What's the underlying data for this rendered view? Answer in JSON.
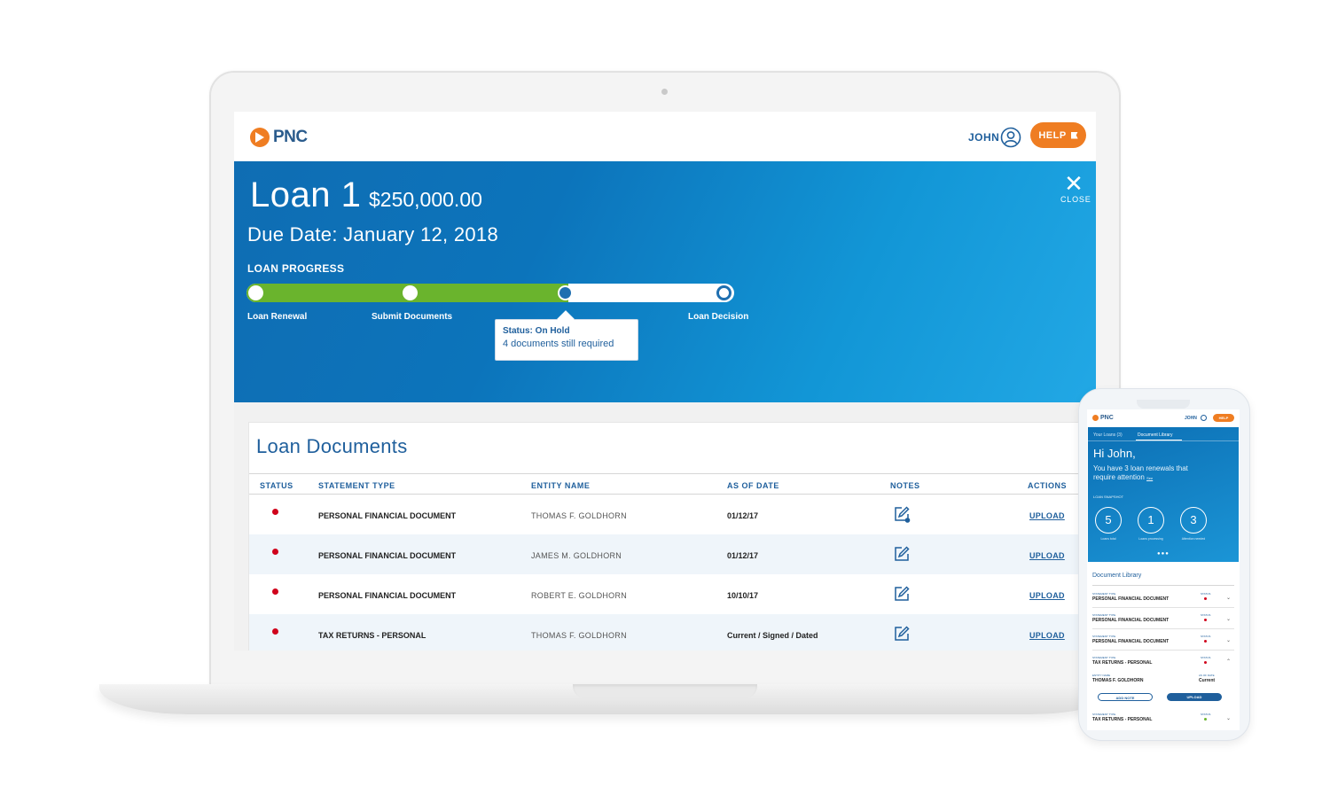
{
  "brand": {
    "name": "PNC",
    "accent": "#ef7d22",
    "primary": "#1f5f9c"
  },
  "header": {
    "user_name": "JOHN",
    "help_label": "HELP"
  },
  "loan": {
    "title": "Loan 1",
    "amount": "$250,000.00",
    "due_date": "Due Date: January 12, 2018",
    "close_label": "CLOSE",
    "progress_label": "LOAN PROGRESS",
    "progress_fraction": 0.66,
    "steps": [
      {
        "label": "Loan Renewal",
        "state": "complete"
      },
      {
        "label": "Submit Documents",
        "state": "complete"
      },
      {
        "label": "",
        "state": "current"
      },
      {
        "label": "Loan Decision",
        "state": "future"
      }
    ],
    "tooltip": {
      "title": "Status: On Hold",
      "subtitle": "4 documents still required"
    }
  },
  "documents": {
    "title": "Loan Documents",
    "columns": [
      "STATUS",
      "STATEMENT TYPE",
      "ENTITY NAME",
      "AS OF DATE",
      "NOTES",
      "ACTIONS"
    ],
    "rows": [
      {
        "statement_type": "PERSONAL FINANCIAL DOCUMENT",
        "entity": "THOMAS F. GOLDHORN",
        "as_of": "01/12/17",
        "action": "UPLOAD",
        "status_color": "#d0021b",
        "has_note": true
      },
      {
        "statement_type": "PERSONAL FINANCIAL DOCUMENT",
        "entity": "JAMES M. GOLDHORN",
        "as_of": "01/12/17",
        "action": "UPLOAD",
        "status_color": "#d0021b",
        "has_note": false
      },
      {
        "statement_type": "PERSONAL FINANCIAL DOCUMENT",
        "entity": "ROBERT E. GOLDHORN",
        "as_of": "10/10/17",
        "action": "UPLOAD",
        "status_color": "#d0021b",
        "has_note": false
      },
      {
        "statement_type": "TAX RETURNS - PERSONAL",
        "entity": "THOMAS F. GOLDHORN",
        "as_of": "Current / Signed / Dated",
        "action": "UPLOAD",
        "status_color": "#d0021b",
        "has_note": false
      }
    ]
  },
  "phone": {
    "brand": "PNC",
    "user_name": "JOHN",
    "help_label": "HELP",
    "tabs": [
      "Your Loans (3)",
      "Document Library"
    ],
    "greeting": "Hi John,",
    "message": "You have 3 loan renewals that require attention",
    "message_link": "See",
    "snapshot_label": "LOAN SNAPSHOT",
    "stats": [
      {
        "value": "5",
        "label": "Loans total"
      },
      {
        "value": "1",
        "label": "Loans processing"
      },
      {
        "value": "3",
        "label": "Attention needed"
      }
    ],
    "library_title": "Document Library",
    "items": [
      {
        "key": "STATEMENT TYPE",
        "value": "PERSONAL FINANCIAL DOCUMENT",
        "status": "STATUS",
        "color": "#d0021b",
        "chevron": "⌄"
      },
      {
        "key": "STATEMENT TYPE",
        "value": "PERSONAL FINANCIAL DOCUMENT",
        "status": "STATUS",
        "color": "#d0021b",
        "chevron": "⌄"
      },
      {
        "key": "STATEMENT TYPE",
        "value": "PERSONAL FINANCIAL DOCUMENT",
        "status": "STATUS",
        "color": "#d0021b",
        "chevron": "⌄"
      },
      {
        "key": "STATEMENT TYPE",
        "value": "TAX RETURNS - PERSONAL",
        "status": "STATUS",
        "color": "#d0021b",
        "chevron": "⌃"
      },
      {
        "key": "STATEMENT TYPE",
        "value": "TAX RETURNS - PERSONAL",
        "status": "STATUS",
        "color": "#6ab42d",
        "chevron": "⌄"
      }
    ],
    "expanded": {
      "entity_key": "ENTITY NAME",
      "entity_value": "THOMAS F. GOLDHORN",
      "date_key": "AS OF DATE",
      "date_value": "Current",
      "add_note_label": "ADD NOTE",
      "upload_label": "UPLOAD"
    }
  }
}
